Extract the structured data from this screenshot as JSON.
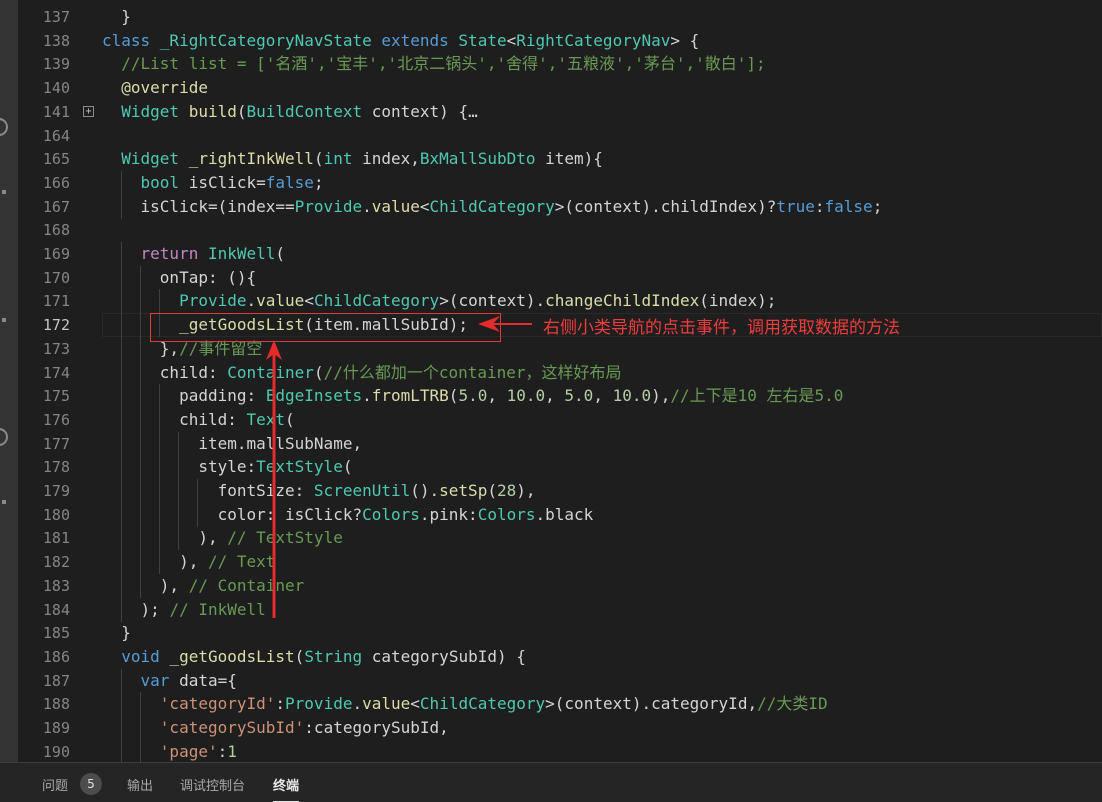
{
  "editor": {
    "current_line": "172",
    "lines": [
      {
        "n": "137",
        "tokens": [
          {
            "c": "",
            "t": "  }"
          }
        ]
      },
      {
        "n": "138",
        "tokens": [
          {
            "c": "kw",
            "t": "class "
          },
          {
            "c": "ty",
            "t": "_RightCategoryNavState "
          },
          {
            "c": "kw",
            "t": "extends "
          },
          {
            "c": "ty",
            "t": "State"
          },
          {
            "c": "",
            "t": "<"
          },
          {
            "c": "ty",
            "t": "RightCategoryNav"
          },
          {
            "c": "",
            "t": "> {"
          }
        ]
      },
      {
        "n": "139",
        "tokens": [
          {
            "c": "cm",
            "t": "  //List list = ['名酒','宝丰','北京二锅头','舍得','五粮液','茅台','散白'];"
          }
        ]
      },
      {
        "n": "140",
        "tokens": [
          {
            "c": "",
            "t": "  "
          },
          {
            "c": "fn",
            "t": "@override"
          }
        ]
      },
      {
        "n": "141",
        "fold": true,
        "tokens": [
          {
            "c": "",
            "t": "  "
          },
          {
            "c": "ty",
            "t": "Widget "
          },
          {
            "c": "fn",
            "t": "build"
          },
          {
            "c": "",
            "t": "("
          },
          {
            "c": "ty",
            "t": "BuildContext "
          },
          {
            "c": "",
            "t": "context) {…"
          }
        ]
      },
      {
        "n": "164",
        "tokens": []
      },
      {
        "n": "165",
        "tokens": [
          {
            "c": "",
            "t": "  "
          },
          {
            "c": "ty",
            "t": "Widget "
          },
          {
            "c": "fn",
            "t": "_rightInkWell"
          },
          {
            "c": "",
            "t": "("
          },
          {
            "c": "ty",
            "t": "int "
          },
          {
            "c": "",
            "t": "index,"
          },
          {
            "c": "ty",
            "t": "BxMallSubDto "
          },
          {
            "c": "",
            "t": "item){"
          }
        ]
      },
      {
        "n": "166",
        "tokens": [
          {
            "c": "",
            "t": "    "
          },
          {
            "c": "ty",
            "t": "bool "
          },
          {
            "c": "",
            "t": "isClick="
          },
          {
            "c": "kw",
            "t": "false"
          },
          {
            "c": "",
            "t": ";"
          }
        ]
      },
      {
        "n": "167",
        "tokens": [
          {
            "c": "",
            "t": "    isClick=(index=="
          },
          {
            "c": "ty",
            "t": "Provide"
          },
          {
            "c": "",
            "t": "."
          },
          {
            "c": "fn",
            "t": "value"
          },
          {
            "c": "",
            "t": "<"
          },
          {
            "c": "ty",
            "t": "ChildCategory"
          },
          {
            "c": "",
            "t": ">(context).childIndex)?"
          },
          {
            "c": "kw",
            "t": "true"
          },
          {
            "c": "",
            "t": ":"
          },
          {
            "c": "kw",
            "t": "false"
          },
          {
            "c": "",
            "t": ";"
          }
        ]
      },
      {
        "n": "168",
        "tokens": []
      },
      {
        "n": "169",
        "tokens": [
          {
            "c": "",
            "t": "    "
          },
          {
            "c": "ctl",
            "t": "return "
          },
          {
            "c": "ty",
            "t": "InkWell"
          },
          {
            "c": "",
            "t": "("
          }
        ]
      },
      {
        "n": "170",
        "tokens": [
          {
            "c": "",
            "t": "      onTap: (){"
          }
        ]
      },
      {
        "n": "171",
        "tokens": [
          {
            "c": "",
            "t": "        "
          },
          {
            "c": "ty",
            "t": "Provide"
          },
          {
            "c": "",
            "t": "."
          },
          {
            "c": "fn",
            "t": "value"
          },
          {
            "c": "",
            "t": "<"
          },
          {
            "c": "ty",
            "t": "ChildCategory"
          },
          {
            "c": "",
            "t": ">(context)."
          },
          {
            "c": "fn",
            "t": "changeChildIndex"
          },
          {
            "c": "",
            "t": "(index);"
          }
        ]
      },
      {
        "n": "172",
        "tokens": [
          {
            "c": "",
            "t": "        "
          },
          {
            "c": "fn",
            "t": "_getGoodsList"
          },
          {
            "c": "",
            "t": "(item.mallSubId);"
          }
        ]
      },
      {
        "n": "173",
        "tokens": [
          {
            "c": "",
            "t": "      },"
          },
          {
            "c": "cm",
            "t": "//事件留空"
          }
        ]
      },
      {
        "n": "174",
        "tokens": [
          {
            "c": "",
            "t": "      child: "
          },
          {
            "c": "ty",
            "t": "Container"
          },
          {
            "c": "",
            "t": "("
          },
          {
            "c": "cm",
            "t": "//什么都加一个container，这样好布局"
          }
        ]
      },
      {
        "n": "175",
        "tokens": [
          {
            "c": "",
            "t": "        padding: "
          },
          {
            "c": "ty",
            "t": "EdgeInsets"
          },
          {
            "c": "",
            "t": "."
          },
          {
            "c": "fn",
            "t": "fromLTRB"
          },
          {
            "c": "",
            "t": "("
          },
          {
            "c": "nu",
            "t": "5.0"
          },
          {
            "c": "",
            "t": ", "
          },
          {
            "c": "nu",
            "t": "10.0"
          },
          {
            "c": "",
            "t": ", "
          },
          {
            "c": "nu",
            "t": "5.0"
          },
          {
            "c": "",
            "t": ", "
          },
          {
            "c": "nu",
            "t": "10.0"
          },
          {
            "c": "",
            "t": "),"
          },
          {
            "c": "cm",
            "t": "//上下是10 左右是5.0"
          }
        ]
      },
      {
        "n": "176",
        "tokens": [
          {
            "c": "",
            "t": "        child: "
          },
          {
            "c": "ty",
            "t": "Text"
          },
          {
            "c": "",
            "t": "("
          }
        ]
      },
      {
        "n": "177",
        "tokens": [
          {
            "c": "",
            "t": "          item.mallSubName,"
          }
        ]
      },
      {
        "n": "178",
        "tokens": [
          {
            "c": "",
            "t": "          style:"
          },
          {
            "c": "ty",
            "t": "TextStyle"
          },
          {
            "c": "",
            "t": "("
          }
        ]
      },
      {
        "n": "179",
        "tokens": [
          {
            "c": "",
            "t": "            fontSize: "
          },
          {
            "c": "ty",
            "t": "ScreenUtil"
          },
          {
            "c": "",
            "t": "()."
          },
          {
            "c": "fn",
            "t": "setSp"
          },
          {
            "c": "",
            "t": "("
          },
          {
            "c": "nu",
            "t": "28"
          },
          {
            "c": "",
            "t": "),"
          }
        ]
      },
      {
        "n": "180",
        "tokens": [
          {
            "c": "",
            "t": "            color: isClick?"
          },
          {
            "c": "ty",
            "t": "Colors"
          },
          {
            "c": "",
            "t": ".pink:"
          },
          {
            "c": "ty",
            "t": "Colors"
          },
          {
            "c": "",
            "t": ".black"
          }
        ]
      },
      {
        "n": "181",
        "tokens": [
          {
            "c": "",
            "t": "          ), "
          },
          {
            "c": "cm",
            "t": "// TextStyle"
          }
        ]
      },
      {
        "n": "182",
        "tokens": [
          {
            "c": "",
            "t": "        ), "
          },
          {
            "c": "cm",
            "t": "// Text"
          }
        ]
      },
      {
        "n": "183",
        "tokens": [
          {
            "c": "",
            "t": "      ), "
          },
          {
            "c": "cm",
            "t": "// Container"
          }
        ]
      },
      {
        "n": "184",
        "tokens": [
          {
            "c": "",
            "t": "    ); "
          },
          {
            "c": "cm",
            "t": "// InkWell"
          }
        ]
      },
      {
        "n": "185",
        "tokens": [
          {
            "c": "",
            "t": "  }"
          }
        ]
      },
      {
        "n": "186",
        "tokens": [
          {
            "c": "",
            "t": "  "
          },
          {
            "c": "kw",
            "t": "void "
          },
          {
            "c": "fn",
            "t": "_getGoodsList"
          },
          {
            "c": "",
            "t": "("
          },
          {
            "c": "ty",
            "t": "String "
          },
          {
            "c": "",
            "t": "categorySubId) {"
          }
        ]
      },
      {
        "n": "187",
        "tokens": [
          {
            "c": "",
            "t": "    "
          },
          {
            "c": "kw",
            "t": "var "
          },
          {
            "c": "",
            "t": "data={"
          }
        ]
      },
      {
        "n": "188",
        "tokens": [
          {
            "c": "",
            "t": "      "
          },
          {
            "c": "st",
            "t": "'categoryId'"
          },
          {
            "c": "",
            "t": ":"
          },
          {
            "c": "ty",
            "t": "Provide"
          },
          {
            "c": "",
            "t": "."
          },
          {
            "c": "fn",
            "t": "value"
          },
          {
            "c": "",
            "t": "<"
          },
          {
            "c": "ty",
            "t": "ChildCategory"
          },
          {
            "c": "",
            "t": ">(context).categoryId,"
          },
          {
            "c": "cm",
            "t": "//大类ID"
          }
        ]
      },
      {
        "n": "189",
        "tokens": [
          {
            "c": "",
            "t": "      "
          },
          {
            "c": "st",
            "t": "'categorySubId'"
          },
          {
            "c": "",
            "t": ":categorySubId,"
          }
        ]
      },
      {
        "n": "190",
        "tokens": [
          {
            "c": "",
            "t": "      "
          },
          {
            "c": "st",
            "t": "'page'"
          },
          {
            "c": "",
            "t": ":"
          },
          {
            "c": "nu",
            "t": "1"
          }
        ]
      }
    ]
  },
  "annotation": {
    "text": "右侧小类导航的点击事件，调用获取数据的方法",
    "color": "#f03c3c"
  },
  "panel": {
    "tabs": [
      {
        "label": "问题",
        "badge": "5"
      },
      {
        "label": "输出"
      },
      {
        "label": "调试控制台"
      },
      {
        "label": "终端",
        "active": true
      }
    ]
  }
}
